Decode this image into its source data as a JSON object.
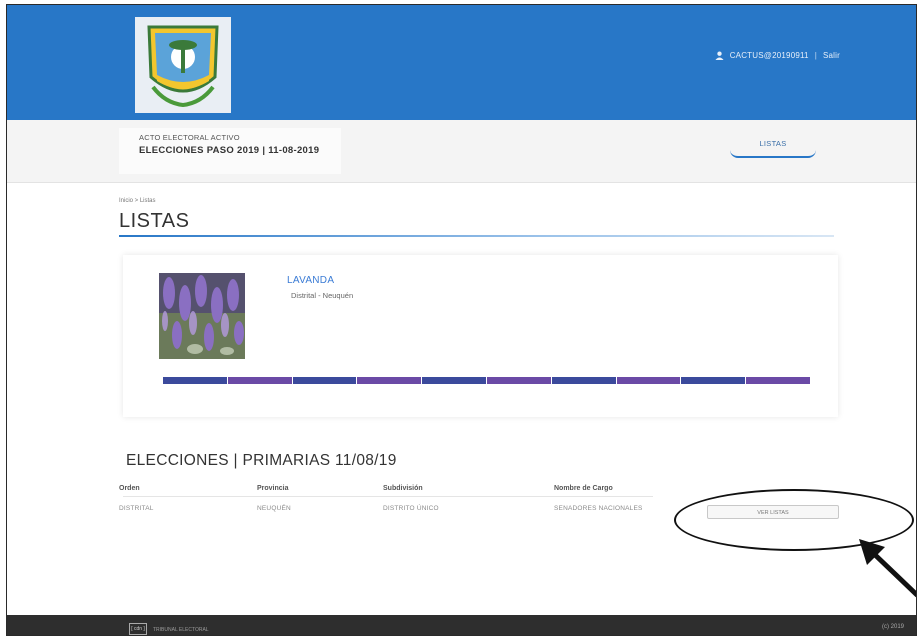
{
  "header": {
    "username": "CACTUS@20190911",
    "separator": "|",
    "logout_label": "Salir",
    "user_icon": "user-icon"
  },
  "subheader": {
    "acto_label": "ACTO ELECTORAL ACTIVO",
    "eleccion_label": "ELECCIONES PASO 2019 | 11-08-2019",
    "nav_listas": "LISTAS"
  },
  "breadcrumb": "Inicio > Listas",
  "page_title": "LISTAS",
  "list_card": {
    "name": "LAVANDA",
    "distrito": "Distrital - Neuquén",
    "stripe_colors": [
      "#3b4a9c",
      "#6b4aa6",
      "#3b4a9c",
      "#6b4aa6",
      "#3b4a9c",
      "#6b4aa6",
      "#3b4a9c",
      "#6b4aa6",
      "#3b4a9c",
      "#6b4aa6"
    ]
  },
  "elections": {
    "title": "ELECCIONES | PRIMARIAS 11/08/19",
    "columns": [
      "Orden",
      "Provincia",
      "Subdivisión",
      "Nombre de Cargo"
    ],
    "rows": [
      {
        "orden": "DISTRITAL",
        "provincia": "NEUQUÉN",
        "subdivision": "DISTRITO ÚNICO",
        "cargo": "SENADORES NACIONALES",
        "action_label": "VER LISTAS"
      }
    ]
  },
  "footer": {
    "logo_text": "[ cdn ]",
    "logo_caption": "TRIBUNAL ELECTORAL",
    "right_text": "(c) 2019"
  },
  "colors": {
    "header_blue": "#2877c7",
    "link_blue": "#3a7bd5",
    "footer_dark": "#2e2e2e"
  }
}
